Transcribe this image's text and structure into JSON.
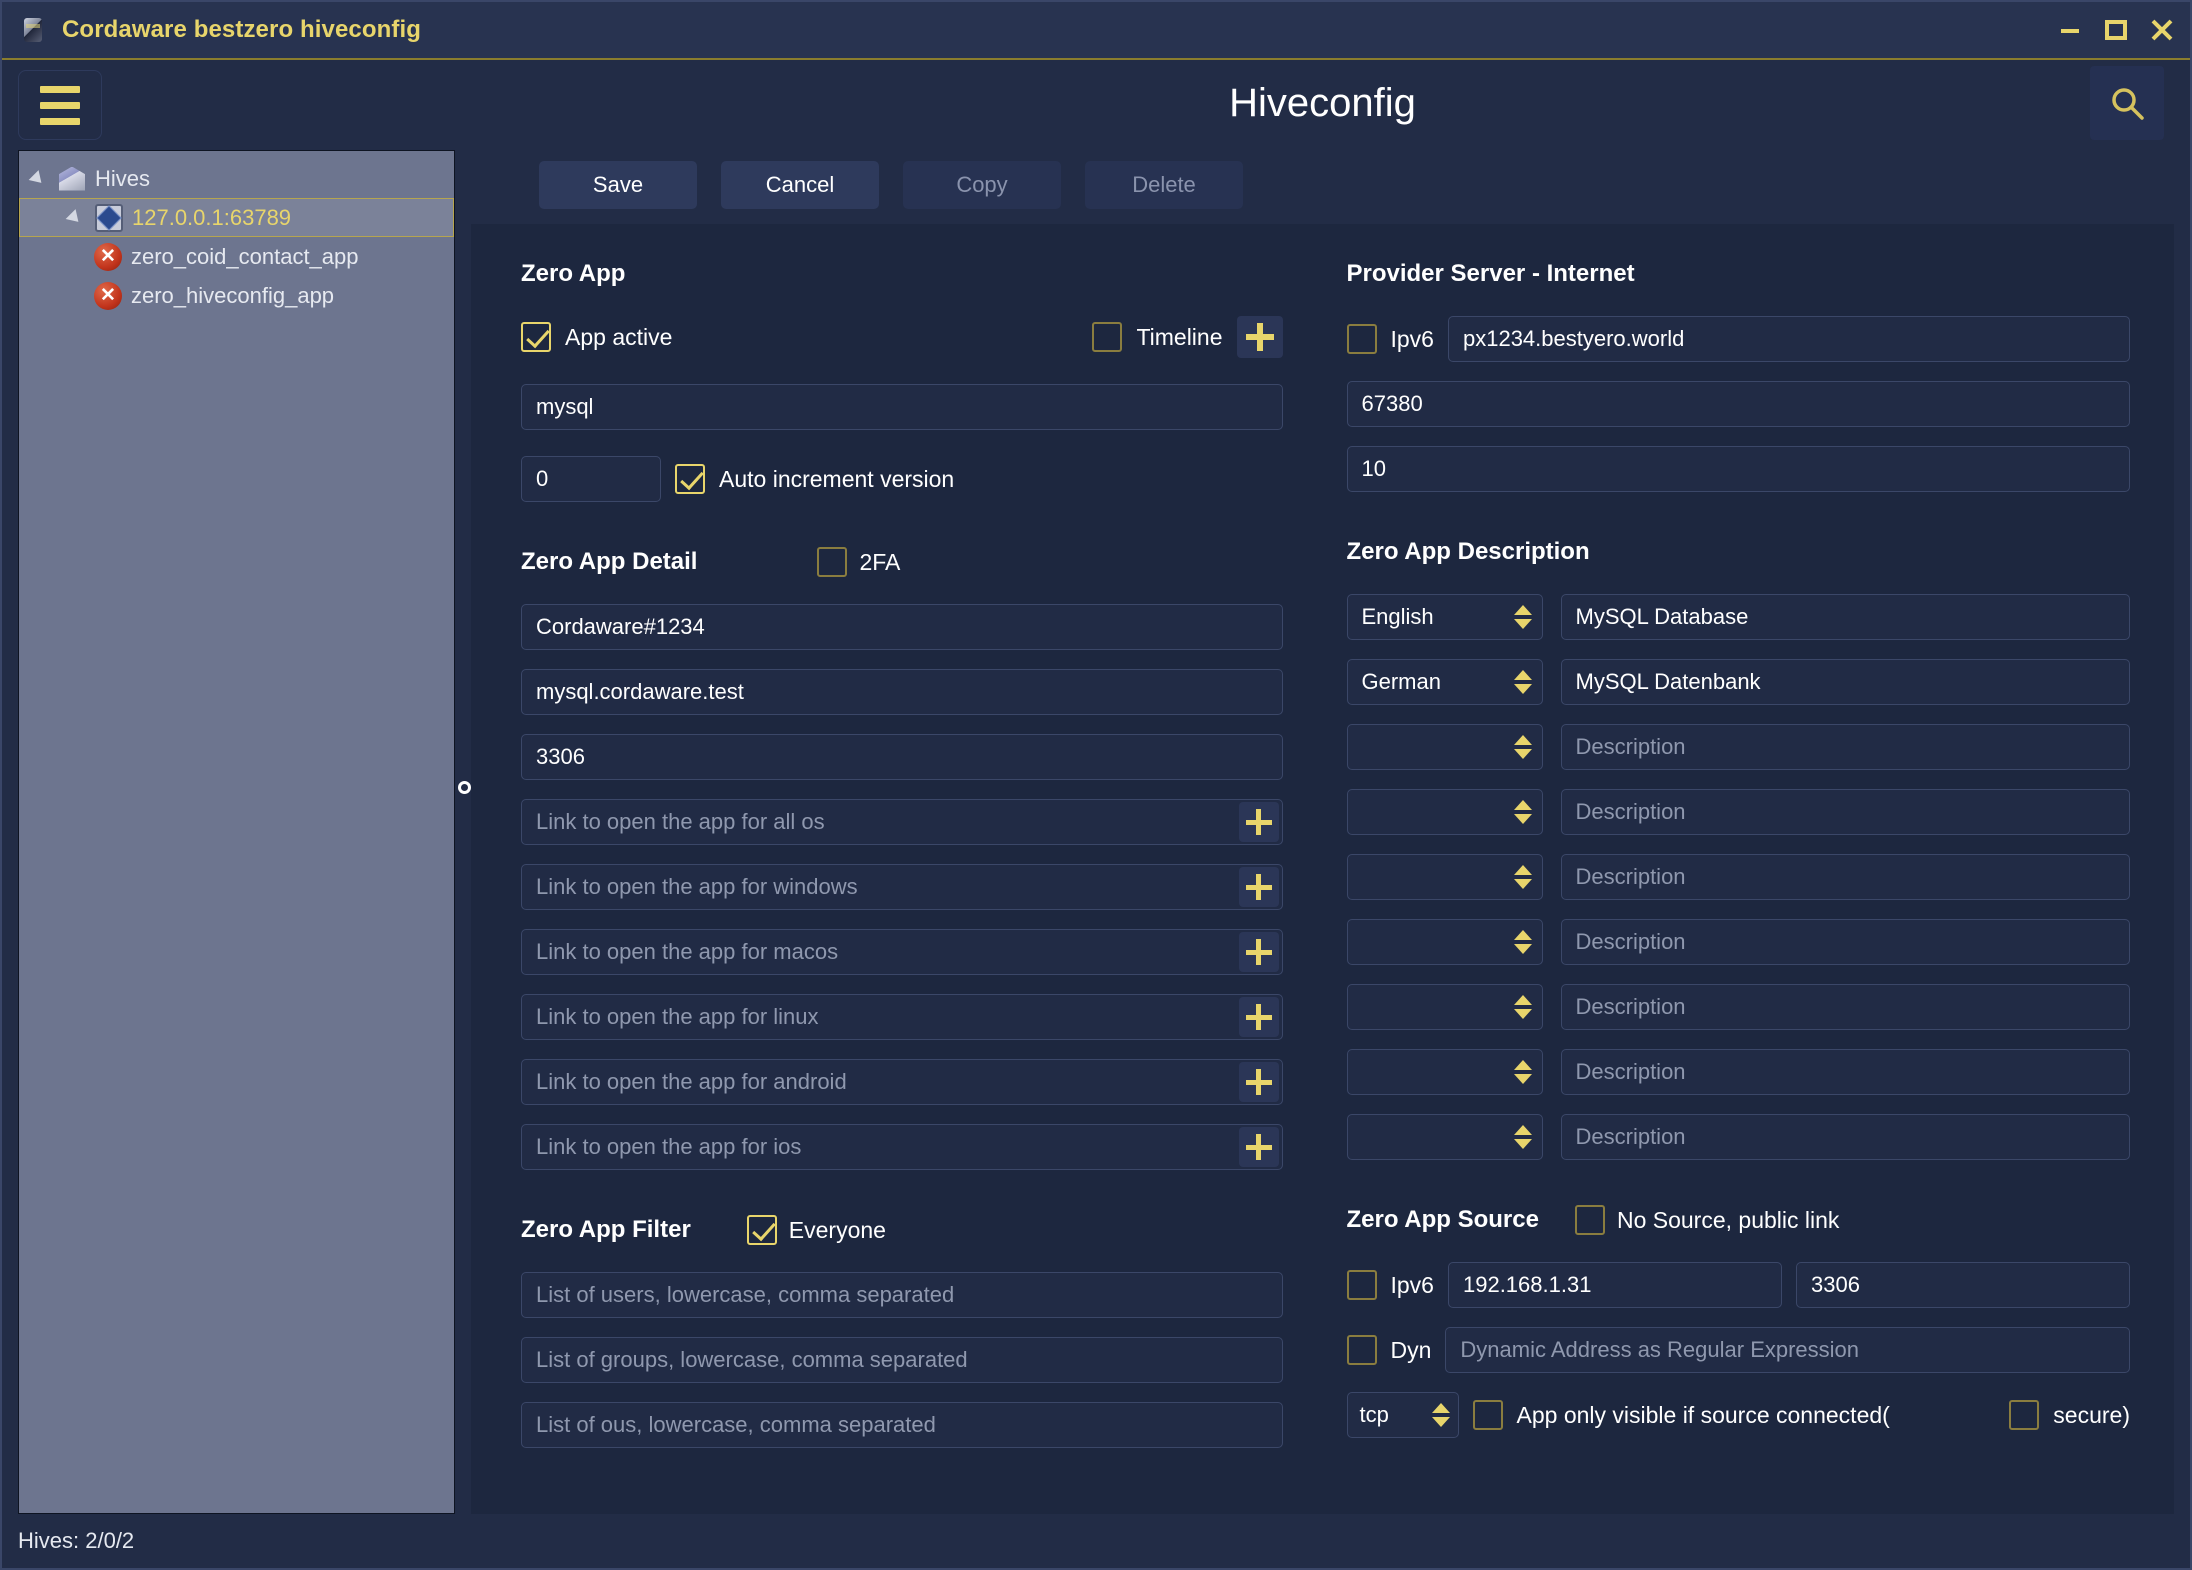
{
  "window": {
    "title": "Cordaware bestzero hiveconfig",
    "icon": "app-icon",
    "controls": {
      "minimize": "minimize-icon",
      "maximize": "maximize-icon",
      "close": "close-icon"
    }
  },
  "sidebar": {
    "menu_icon": "hamburger-icon",
    "tree": [
      {
        "label": "Hives",
        "icon": "hive-icon",
        "depth": 0,
        "expanded": true,
        "selected": false
      },
      {
        "label": "127.0.0.1:63789",
        "icon": "hub-icon",
        "depth": 1,
        "expanded": true,
        "selected": true
      },
      {
        "label": "zero_coid_contact_app",
        "icon": "error-icon",
        "depth": 2,
        "expanded": false,
        "selected": false
      },
      {
        "label": "zero_hiveconfig_app",
        "icon": "error-icon",
        "depth": 2,
        "expanded": false,
        "selected": false
      }
    ]
  },
  "header": {
    "page_title": "Hiveconfig",
    "search_icon": "search-icon"
  },
  "toolbar": {
    "save_label": "Save",
    "cancel_label": "Cancel",
    "copy_label": "Copy",
    "delete_label": "Delete"
  },
  "zero_app": {
    "heading": "Zero App",
    "app_active_label": "App active",
    "app_active_checked": true,
    "timeline_label": "Timeline",
    "timeline_checked": false,
    "add_icon": "plus-icon",
    "name_value": "mysql",
    "name_placeholder": "",
    "version_value": "0",
    "auto_increment_label": "Auto increment version",
    "auto_increment_checked": true
  },
  "provider_server": {
    "heading": "Provider Server - Internet",
    "ipv6_label": "Ipv6",
    "ipv6_checked": false,
    "host_value": "px1234.bestyero.world",
    "port_value": "67380",
    "count_value": "10"
  },
  "zero_app_detail": {
    "heading": "Zero App Detail",
    "twofa_label": "2FA",
    "twofa_checked": false,
    "secret_value": "Cordaware#1234",
    "host_value": "mysql.cordaware.test",
    "port_value": "3306",
    "links": [
      {
        "placeholder": "Link to open the app for all os",
        "add_icon": "plus-icon"
      },
      {
        "placeholder": "Link to open the app for windows",
        "add_icon": "plus-icon"
      },
      {
        "placeholder": "Link to open the app for macos",
        "add_icon": "plus-icon"
      },
      {
        "placeholder": "Link to open the app for linux",
        "add_icon": "plus-icon"
      },
      {
        "placeholder": "Link to open the app for android",
        "add_icon": "plus-icon"
      },
      {
        "placeholder": "Link to open the app for ios",
        "add_icon": "plus-icon"
      }
    ]
  },
  "zero_app_description": {
    "heading": "Zero App Description",
    "rows": [
      {
        "language": "English",
        "description": "MySQL Database",
        "description_placeholder": "Description"
      },
      {
        "language": "German",
        "description": "MySQL Datenbank",
        "description_placeholder": "Description"
      },
      {
        "language": "",
        "description": "",
        "description_placeholder": "Description"
      },
      {
        "language": "",
        "description": "",
        "description_placeholder": "Description"
      },
      {
        "language": "",
        "description": "",
        "description_placeholder": "Description"
      },
      {
        "language": "",
        "description": "",
        "description_placeholder": "Description"
      },
      {
        "language": "",
        "description": "",
        "description_placeholder": "Description"
      },
      {
        "language": "",
        "description": "",
        "description_placeholder": "Description"
      },
      {
        "language": "",
        "description": "",
        "description_placeholder": "Description"
      }
    ]
  },
  "zero_app_filter": {
    "heading": "Zero App Filter",
    "everyone_label": "Everyone",
    "everyone_checked": true,
    "users_placeholder": "List of users, lowercase, comma separated",
    "groups_placeholder": "List of groups, lowercase, comma separated",
    "ous_placeholder": "List of ous, lowercase, comma separated"
  },
  "zero_app_source": {
    "heading": "Zero App Source",
    "no_source_label": "No Source, public link",
    "no_source_checked": false,
    "ipv6_label": "Ipv6",
    "ipv6_checked": false,
    "address_value": "192.168.1.31",
    "port_value": "3306",
    "dyn_label": "Dyn",
    "dyn_checked": false,
    "dyn_placeholder": "Dynamic Address as Regular Expression",
    "protocol_value": "tcp",
    "only_visible_label": "App only visible if source connected(",
    "only_visible_checked": false,
    "secure_label": "secure)",
    "secure_checked": false
  },
  "statusbar": {
    "text": "Hives: 2/0/2"
  },
  "colors": {
    "accent": "#e8d56b",
    "titlebar_bg": "#283350",
    "panel_bg": "#1d273f",
    "chrome_bg": "#222c46",
    "tree_bg": "#6d758f"
  }
}
